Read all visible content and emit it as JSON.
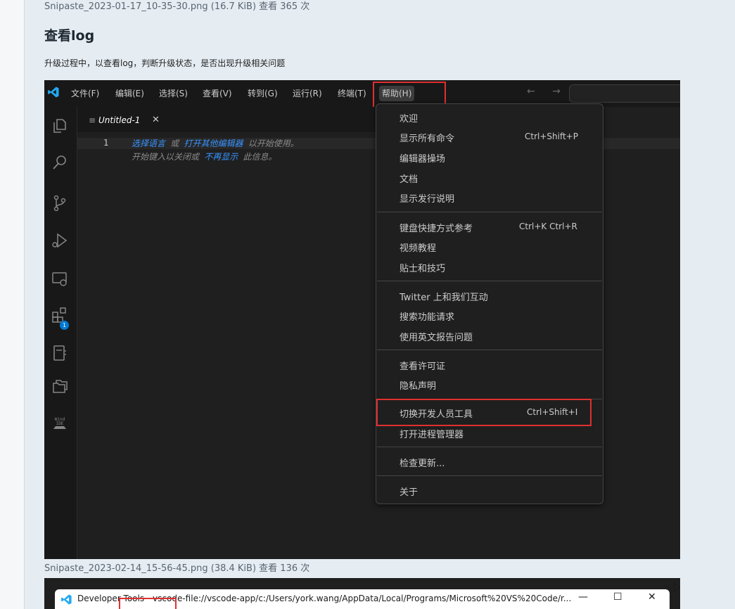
{
  "captions": {
    "top": "Snipaste_2023-01-17_10-35-30.png (16.7 KiB) 查看 365 次",
    "middle": "Snipaste_2023-02-14_15-56-45.png (38.4 KiB) 查看 136 次"
  },
  "section": {
    "heading": "查看log",
    "paragraph": "升级过程中，以查看log，判断升级状态，是否出现升级相关问题"
  },
  "vscode": {
    "menubar": [
      "文件(F)",
      "编辑(E)",
      "选择(S)",
      "查看(V)",
      "转到(G)",
      "运行(R)",
      "终端(T)",
      "帮助(H)"
    ],
    "nav_arrows": "← →",
    "tab": {
      "title": "Untitled-1",
      "close": "✕",
      "lines_icon": "≡"
    },
    "editor": {
      "line_number": "1",
      "line1": {
        "link1": "选择语言",
        "mid1": " 或 ",
        "link2": "打开其他编辑器",
        "tail": " 以开始使用。"
      },
      "line2": {
        "head": "开始键入以关闭或 ",
        "link": "不再显示",
        "tail": " 此信息。"
      }
    },
    "activity_badge": "1",
    "wind_ide_label": "Wind IDE",
    "help_menu": {
      "groups": [
        [
          {
            "label": "欢迎",
            "key": ""
          },
          {
            "label": "显示所有命令",
            "key": "Ctrl+Shift+P"
          },
          {
            "label": "编辑器操场",
            "key": ""
          },
          {
            "label": "文档",
            "key": ""
          },
          {
            "label": "显示发行说明",
            "key": ""
          }
        ],
        [
          {
            "label": "键盘快捷方式参考",
            "key": "Ctrl+K Ctrl+R"
          },
          {
            "label": "视频教程",
            "key": ""
          },
          {
            "label": "贴士和技巧",
            "key": ""
          }
        ],
        [
          {
            "label": "Twitter 上和我们互动",
            "key": ""
          },
          {
            "label": "搜索功能请求",
            "key": ""
          },
          {
            "label": "使用英文报告问题",
            "key": ""
          }
        ],
        [
          {
            "label": "查看许可证",
            "key": ""
          },
          {
            "label": "隐私声明",
            "key": ""
          }
        ],
        [
          {
            "label": "切换开发人员工具",
            "key": "Ctrl+Shift+I"
          },
          {
            "label": "打开进程管理器",
            "key": ""
          }
        ],
        [
          {
            "label": "检查更新...",
            "key": ""
          }
        ],
        [
          {
            "label": "关于",
            "key": ""
          }
        ]
      ]
    }
  },
  "devtools_window": {
    "title": "Developer Tools - vscode-file://vscode-app/c:/Users/york.wang/AppData/Local/Programs/Microsoft%20VS%20Code/r...",
    "minimize": "—",
    "maximize": "☐",
    "close": "✕"
  },
  "colors": {
    "highlight_red": "#e03030",
    "link_blue": "#3794ff",
    "vscode_logo": "#23a9f2"
  }
}
